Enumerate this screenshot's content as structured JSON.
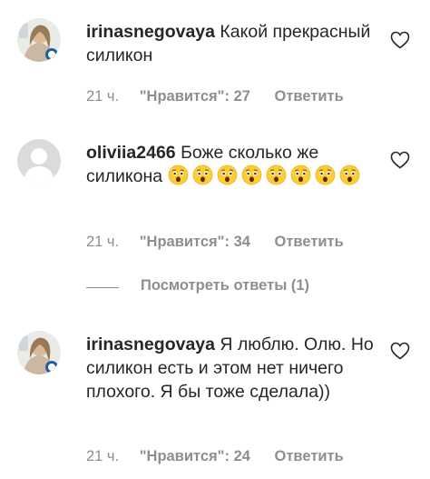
{
  "comments": [
    {
      "username": "irinasnegovaya",
      "text": "Какой прекрасный силикон",
      "time": "21 ч.",
      "likes": "\"Нравится\": 27",
      "reply": "Ответить",
      "avatar": "profile-photo"
    },
    {
      "username": "oliviia2466",
      "text": "Боже сколько же силикона",
      "emoji_count": 8,
      "emoji_name": "astonished-face",
      "time": "21 ч.",
      "likes": "\"Нравится\": 34",
      "reply": "Ответить",
      "avatar": "default-avatar"
    },
    {
      "username": "irinasnegovaya",
      "text": "Я люблю. Олю. Но силикон есть и этом нет ничего плохого. Я бы тоже сделала))",
      "time": "21 ч.",
      "likes": "\"Нравится\": 24",
      "reply": "Ответить",
      "avatar": "profile-photo"
    }
  ],
  "view_replies": "Посмотреть ответы (1)",
  "icons": {
    "like": "heart-outline-icon"
  },
  "colors": {
    "text": "#262626",
    "secondary": "#8e8e8e",
    "emoji_face": "#FFCC33",
    "default_avatar_bg": "#dbdbdb"
  }
}
